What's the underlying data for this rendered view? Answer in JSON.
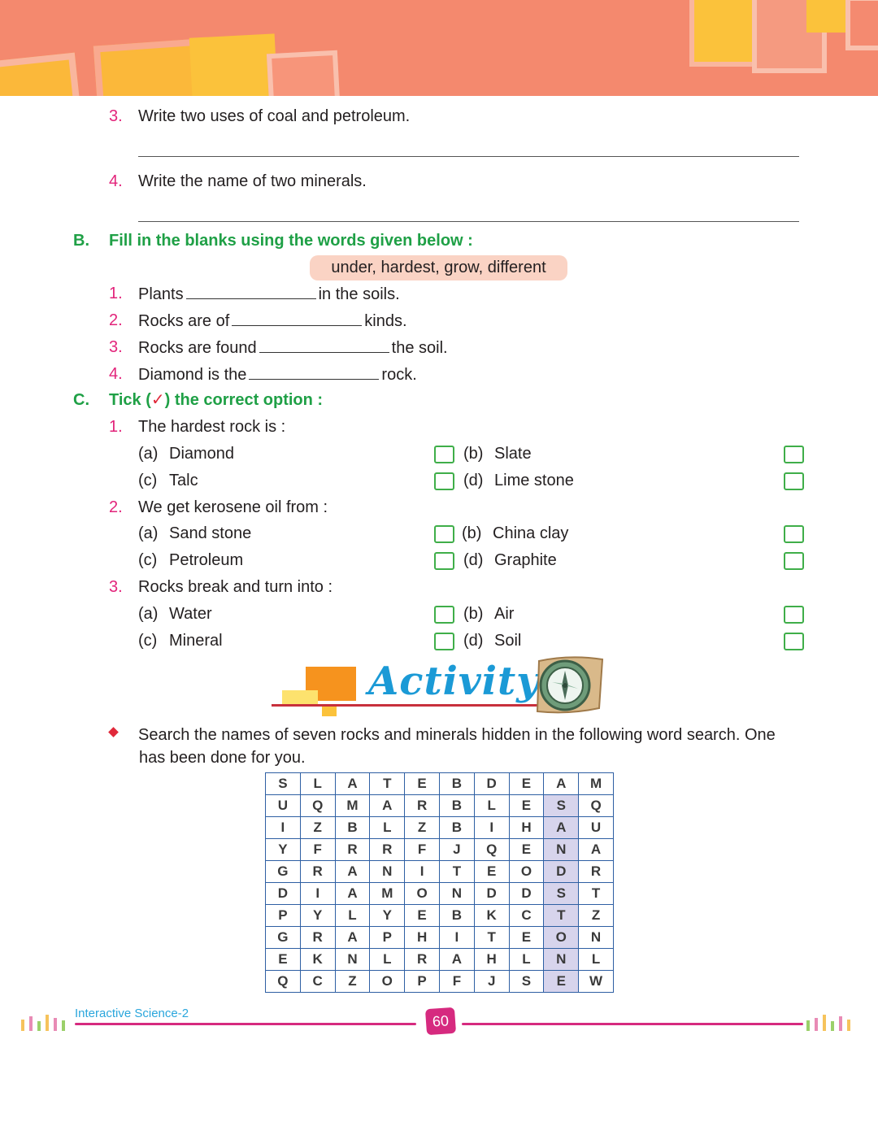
{
  "colors": {
    "banner": "#f4896e",
    "section_green": "#1fa046",
    "number_pink": "#e2237a",
    "checkbox_green": "#3fae49",
    "activity_blue": "#1b9ad6",
    "footer_pink": "#d62a7f",
    "grid_blue": "#2e5fa3",
    "highlight": "#d7d4ec"
  },
  "section_a": {
    "q3": {
      "num": "3.",
      "text": "Write two uses of coal and petroleum."
    },
    "q4": {
      "num": "4.",
      "text": "Write the name of two minerals."
    }
  },
  "section_b": {
    "letter": "B.",
    "title": "Fill in the blanks using the words given below :",
    "word_box": "under, hardest, grow, different",
    "items": [
      {
        "num": "1.",
        "before": "Plants",
        "after": "in the soils."
      },
      {
        "num": "2.",
        "before": "Rocks are of",
        "after": "kinds."
      },
      {
        "num": "3.",
        "before": "Rocks are found",
        "after": "the soil."
      },
      {
        "num": "4.",
        "before": "Diamond is the",
        "after": "rock."
      }
    ]
  },
  "section_c": {
    "letter": "C.",
    "title_before": "Tick (",
    "tick_mark": "✓",
    "title_after": ") the correct option :",
    "questions": [
      {
        "num": "1.",
        "text": "The hardest rock is :",
        "a": "(a)",
        "a_text": "Diamond",
        "b": "(b)",
        "b_text": "Slate",
        "c": "(c)",
        "c_text": "Talc",
        "d": "(d)",
        "d_text": "Lime stone"
      },
      {
        "num": "2.",
        "text": "We get kerosene oil from :",
        "a": "(a)",
        "a_text": "Sand stone",
        "b": "(b)",
        "b_text": "China clay",
        "c": "(c)",
        "c_text": "Petroleum",
        "d": "(d)",
        "d_text": "Graphite"
      },
      {
        "num": "3.",
        "text": "Rocks break and turn into :",
        "a": "(a)",
        "a_text": "Water",
        "b": "(b)",
        "b_text": "Air",
        "c": "(c)",
        "c_text": "Mineral",
        "d": "(d)",
        "d_text": "Soil"
      }
    ]
  },
  "activity": {
    "title": "Activity",
    "icon": "compass-icon",
    "instruction_line1": "Search the names of seven rocks and minerals hidden in the following word search. One",
    "instruction_line2": "has been done for you."
  },
  "word_search": {
    "rows": [
      [
        "S",
        "L",
        "A",
        "T",
        "E",
        "B",
        "D",
        "E",
        "A",
        "M"
      ],
      [
        "U",
        "Q",
        "M",
        "A",
        "R",
        "B",
        "L",
        "E",
        "S",
        "Q"
      ],
      [
        "I",
        "Z",
        "B",
        "L",
        "Z",
        "B",
        "I",
        "H",
        "A",
        "U"
      ],
      [
        "Y",
        "F",
        "R",
        "R",
        "F",
        "J",
        "Q",
        "E",
        "N",
        "A"
      ],
      [
        "G",
        "R",
        "A",
        "N",
        "I",
        "T",
        "E",
        "O",
        "D",
        "R"
      ],
      [
        "D",
        "I",
        "A",
        "M",
        "O",
        "N",
        "D",
        "D",
        "S",
        "T"
      ],
      [
        "P",
        "Y",
        "L",
        "Y",
        "E",
        "B",
        "K",
        "C",
        "T",
        "Z"
      ],
      [
        "G",
        "R",
        "A",
        "P",
        "H",
        "I",
        "T",
        "E",
        "O",
        "N"
      ],
      [
        "E",
        "K",
        "N",
        "L",
        "R",
        "A",
        "H",
        "L",
        "N",
        "L"
      ],
      [
        "Q",
        "C",
        "Z",
        "O",
        "P",
        "F",
        "J",
        "S",
        "E",
        "W"
      ]
    ],
    "found_word": "SANDSTONE",
    "highlight_column": 8,
    "highlight_rows": [
      1,
      9
    ]
  },
  "footer": {
    "book_title": "Interactive Science-2",
    "page_number": "60"
  }
}
